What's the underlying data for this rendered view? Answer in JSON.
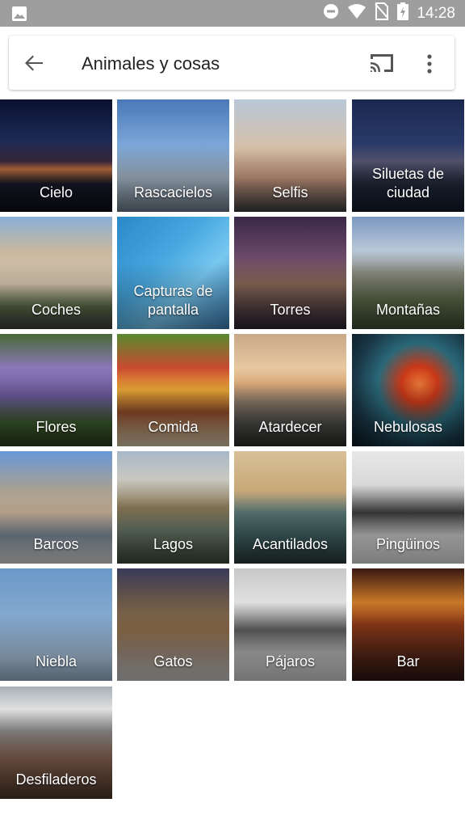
{
  "status_bar": {
    "time": "14:28",
    "icons": [
      "image-notification-icon",
      "do-not-disturb-icon",
      "wifi-icon",
      "no-sim-icon",
      "battery-charging-icon"
    ]
  },
  "app_bar": {
    "title": "Animales y cosas",
    "back_icon": "arrow-back-icon",
    "cast_icon": "cast-icon",
    "more_icon": "more-vert-icon"
  },
  "tiles": [
    {
      "label": "Cielo"
    },
    {
      "label": "Rascacielos"
    },
    {
      "label": "Selfis"
    },
    {
      "label": "Siluetas de ciudad"
    },
    {
      "label": "Coches"
    },
    {
      "label": "Capturas de pantalla"
    },
    {
      "label": "Torres"
    },
    {
      "label": "Montañas"
    },
    {
      "label": "Flores"
    },
    {
      "label": "Comida"
    },
    {
      "label": "Atardecer"
    },
    {
      "label": "Nebulosas"
    },
    {
      "label": "Barcos"
    },
    {
      "label": "Lagos"
    },
    {
      "label": "Acantilados"
    },
    {
      "label": "Pingüinos"
    },
    {
      "label": "Niebla"
    },
    {
      "label": "Gatos"
    },
    {
      "label": "Pájaros"
    },
    {
      "label": "Bar"
    },
    {
      "label": "Desfiladeros"
    }
  ]
}
